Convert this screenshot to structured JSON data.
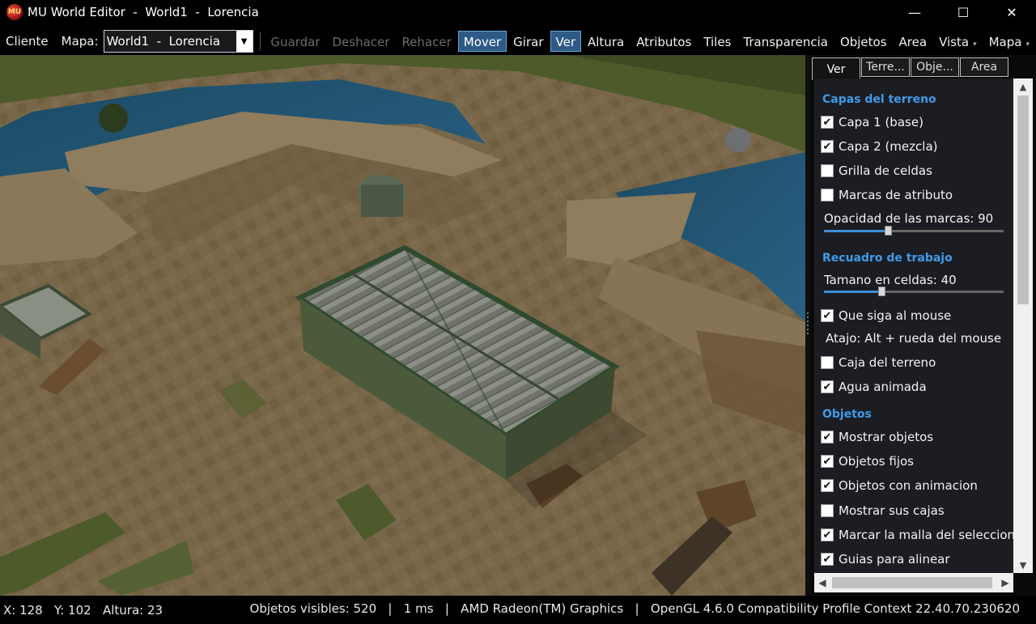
{
  "window": {
    "icon_text": "MU",
    "title": "MU World Editor  -  World1  -  Lorencia",
    "minimize": "—",
    "maximize": "☐",
    "close": "✕"
  },
  "toolbar": {
    "client_label": "Cliente",
    "map_label": "Mapa:",
    "map_value": "World1  -  Lorencia",
    "dropdown_arrow": "▼",
    "buttons": [
      {
        "label": "Guardar",
        "state": "disabled"
      },
      {
        "label": "Deshacer",
        "state": "disabled"
      },
      {
        "label": "Rehacer",
        "state": "disabled"
      },
      {
        "label": "Mover",
        "state": "active"
      },
      {
        "label": "Girar",
        "state": "normal"
      },
      {
        "label": "Ver",
        "state": "active"
      },
      {
        "label": "Altura",
        "state": "normal"
      },
      {
        "label": "Atributos",
        "state": "normal"
      },
      {
        "label": "Tiles",
        "state": "normal"
      },
      {
        "label": "Transparencia",
        "state": "normal"
      },
      {
        "label": "Objetos",
        "state": "normal"
      },
      {
        "label": "Area",
        "state": "normal"
      },
      {
        "label": "Vista",
        "state": "normal"
      },
      {
        "label": "Mapa",
        "state": "normal"
      }
    ],
    "menu_caret": "▾"
  },
  "panel": {
    "tabs": [
      "Ver",
      "Terre...",
      "Obje...",
      "Area"
    ],
    "sections": {
      "terrain_layers": "Capas del terreno",
      "work_frame": "Recuadro de trabajo",
      "objects": "Objetos"
    },
    "checks": {
      "layer1": {
        "label": "Capa 1 (base)",
        "checked": true
      },
      "layer2": {
        "label": "Capa 2 (mezcla)",
        "checked": true
      },
      "cell_grid": {
        "label": "Grilla de celdas",
        "checked": false
      },
      "attr_marks": {
        "label": "Marcas de atributo",
        "checked": false
      },
      "follow_mouse": {
        "label": "Que siga al mouse",
        "checked": true
      },
      "terrain_box": {
        "label": "Caja del terreno",
        "checked": false
      },
      "animated_water": {
        "label": "Agua animada",
        "checked": true
      },
      "show_objects": {
        "label": "Mostrar objetos",
        "checked": true
      },
      "fixed_objects": {
        "label": "Objetos fijos",
        "checked": true
      },
      "animated_objects": {
        "label": "Objetos con animacion",
        "checked": true
      },
      "show_boxes": {
        "label": "Mostrar sus cajas",
        "checked": false
      },
      "mark_mesh": {
        "label": "Marcar la malla del seleccionado",
        "checked": true
      },
      "guides": {
        "label": "Guias para alinear",
        "checked": true
      }
    },
    "mark_opacity": {
      "label": "Opacidad de las marcas: 90",
      "value": 90,
      "max": 255
    },
    "cell_size": {
      "label": "Tamano en celdas: 40",
      "value": 40,
      "max": 128
    },
    "shortcut": "Atajo: Alt + rueda del mouse",
    "scroll_up": "▲",
    "scroll_down": "▼",
    "scroll_left": "◀",
    "scroll_right": "▶"
  },
  "status": {
    "left": "X: 128   Y: 102   Altura: 23",
    "right": "Objetos visibles: 520   |   1 ms   |   AMD Radeon(TM) Graphics   |   OpenGL 4.6.0 Compatibility Profile Context 22.40.70.230620"
  },
  "colors": {
    "section_heading": "#3f9be8",
    "active_button": "#2e5a86",
    "slider_fill": "#3f8fd8"
  }
}
